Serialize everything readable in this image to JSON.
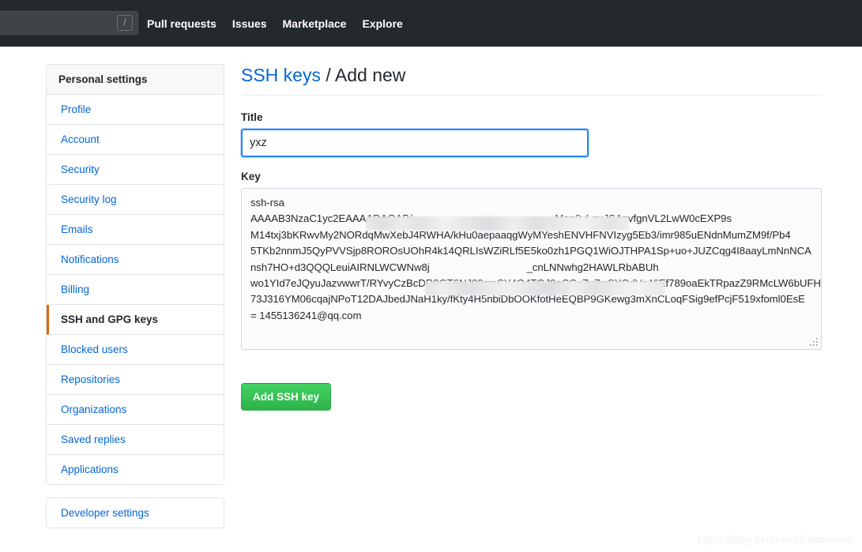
{
  "header": {
    "search": {
      "value": "",
      "placeholder": "",
      "shortcut_badge": "/"
    },
    "nav": [
      {
        "label": "Pull requests"
      },
      {
        "label": "Issues"
      },
      {
        "label": "Marketplace"
      },
      {
        "label": "Explore"
      }
    ]
  },
  "sidebar": {
    "heading": "Personal settings",
    "items": [
      {
        "label": "Profile",
        "selected": false
      },
      {
        "label": "Account",
        "selected": false
      },
      {
        "label": "Security",
        "selected": false
      },
      {
        "label": "Security log",
        "selected": false
      },
      {
        "label": "Emails",
        "selected": false
      },
      {
        "label": "Notifications",
        "selected": false
      },
      {
        "label": "Billing",
        "selected": false
      },
      {
        "label": "SSH and GPG keys",
        "selected": true
      },
      {
        "label": "Blocked users",
        "selected": false
      },
      {
        "label": "Repositories",
        "selected": false
      },
      {
        "label": "Organizations",
        "selected": false
      },
      {
        "label": "Saved replies",
        "selected": false
      },
      {
        "label": "Applications",
        "selected": false
      }
    ],
    "developer": {
      "label": "Developer settings"
    }
  },
  "main": {
    "title_link": "SSH keys",
    "title_separator": " / ",
    "title_current": "Add new",
    "title_field": {
      "label": "Title",
      "value": "yxz",
      "placeholder": ""
    },
    "key_field": {
      "label": "Key",
      "value": "ssh-rsa\nAAAAB3NzaC1yc2EAAAADAQAB/                                                  Mop9yLquJSAnvfgnVL2LwW0cEXP9s\nM14txj3bKRwvMy2NORdqMwXebJ4RWHA/kHu0aepaaqgWyMYeshENVHFNVIzyg5Eb3/imr985uENdnMumZM9f/Pb4\n5TKb2nnmJ5QyPVVSjp8ROROsUOhR4k14QRLIsWZiRLf5E5ko0zh1PGQ1WiOJTHPA1Sp+uo+JUZCqg4I8aayLmNnNCA\nnsh7HO+d3QQQLeuiAIRNLWCWNw8j                                  _cnLNNwhg2HAWLRbABUh\nwo1YId7eJQyuJazvwwrT/RYvyCzBcDR8GT6NJ00cmSY4O4TGJ9oCGxZu7wSYOdVs46Ef789oaEkTRpazZ9RMcLW6bUFH\n73J316YM06cqajNPoT12DAJbedJNaH1ky/fKty4H5nbiDbOOKfotHeEQBP9GKewg3mXnCLoqFSig9efPcjF519xfoml0EsE\n= 1455136241@qq.com",
      "placeholder": ""
    },
    "submit_label": "Add SSH key"
  },
  "watermark": "https://blog.csdn.net/Eastmount",
  "colors": {
    "header_bg": "#24292e",
    "link": "#0366d6",
    "selected_accent": "#e36209",
    "button_green": "#2eb14a",
    "focus_border": "#2188ff"
  }
}
